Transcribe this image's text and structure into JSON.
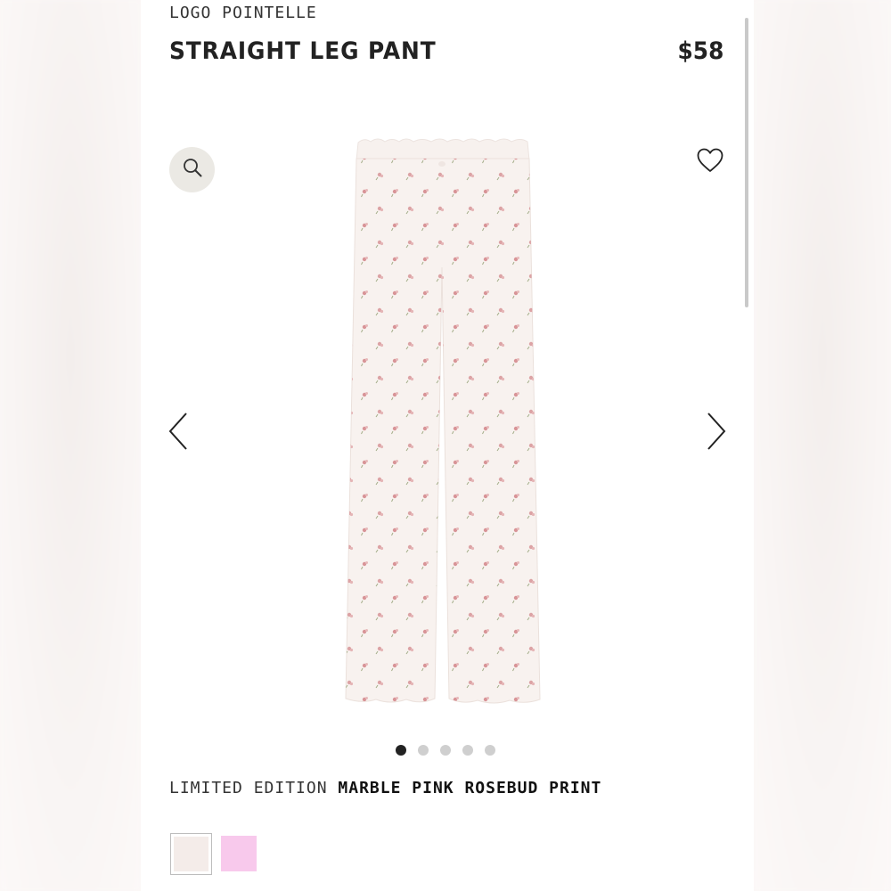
{
  "product": {
    "collection": "LOGO POINTELLE",
    "title": "STRAIGHT LEG PANT",
    "price": "$58"
  },
  "gallery": {
    "dots": [
      true,
      false,
      false,
      false,
      false
    ]
  },
  "color": {
    "label": "LIMITED EDITION",
    "name": "MARBLE PINK ROSEBUD PRINT"
  },
  "swatches": [
    {
      "color": "#f4ece9",
      "selected": true
    },
    {
      "color": "#f8c9ec",
      "selected": false
    }
  ],
  "icons": {
    "zoom": "search-icon",
    "wishlist": "heart-icon",
    "prev": "chevron-left-icon",
    "next": "chevron-right-icon"
  }
}
